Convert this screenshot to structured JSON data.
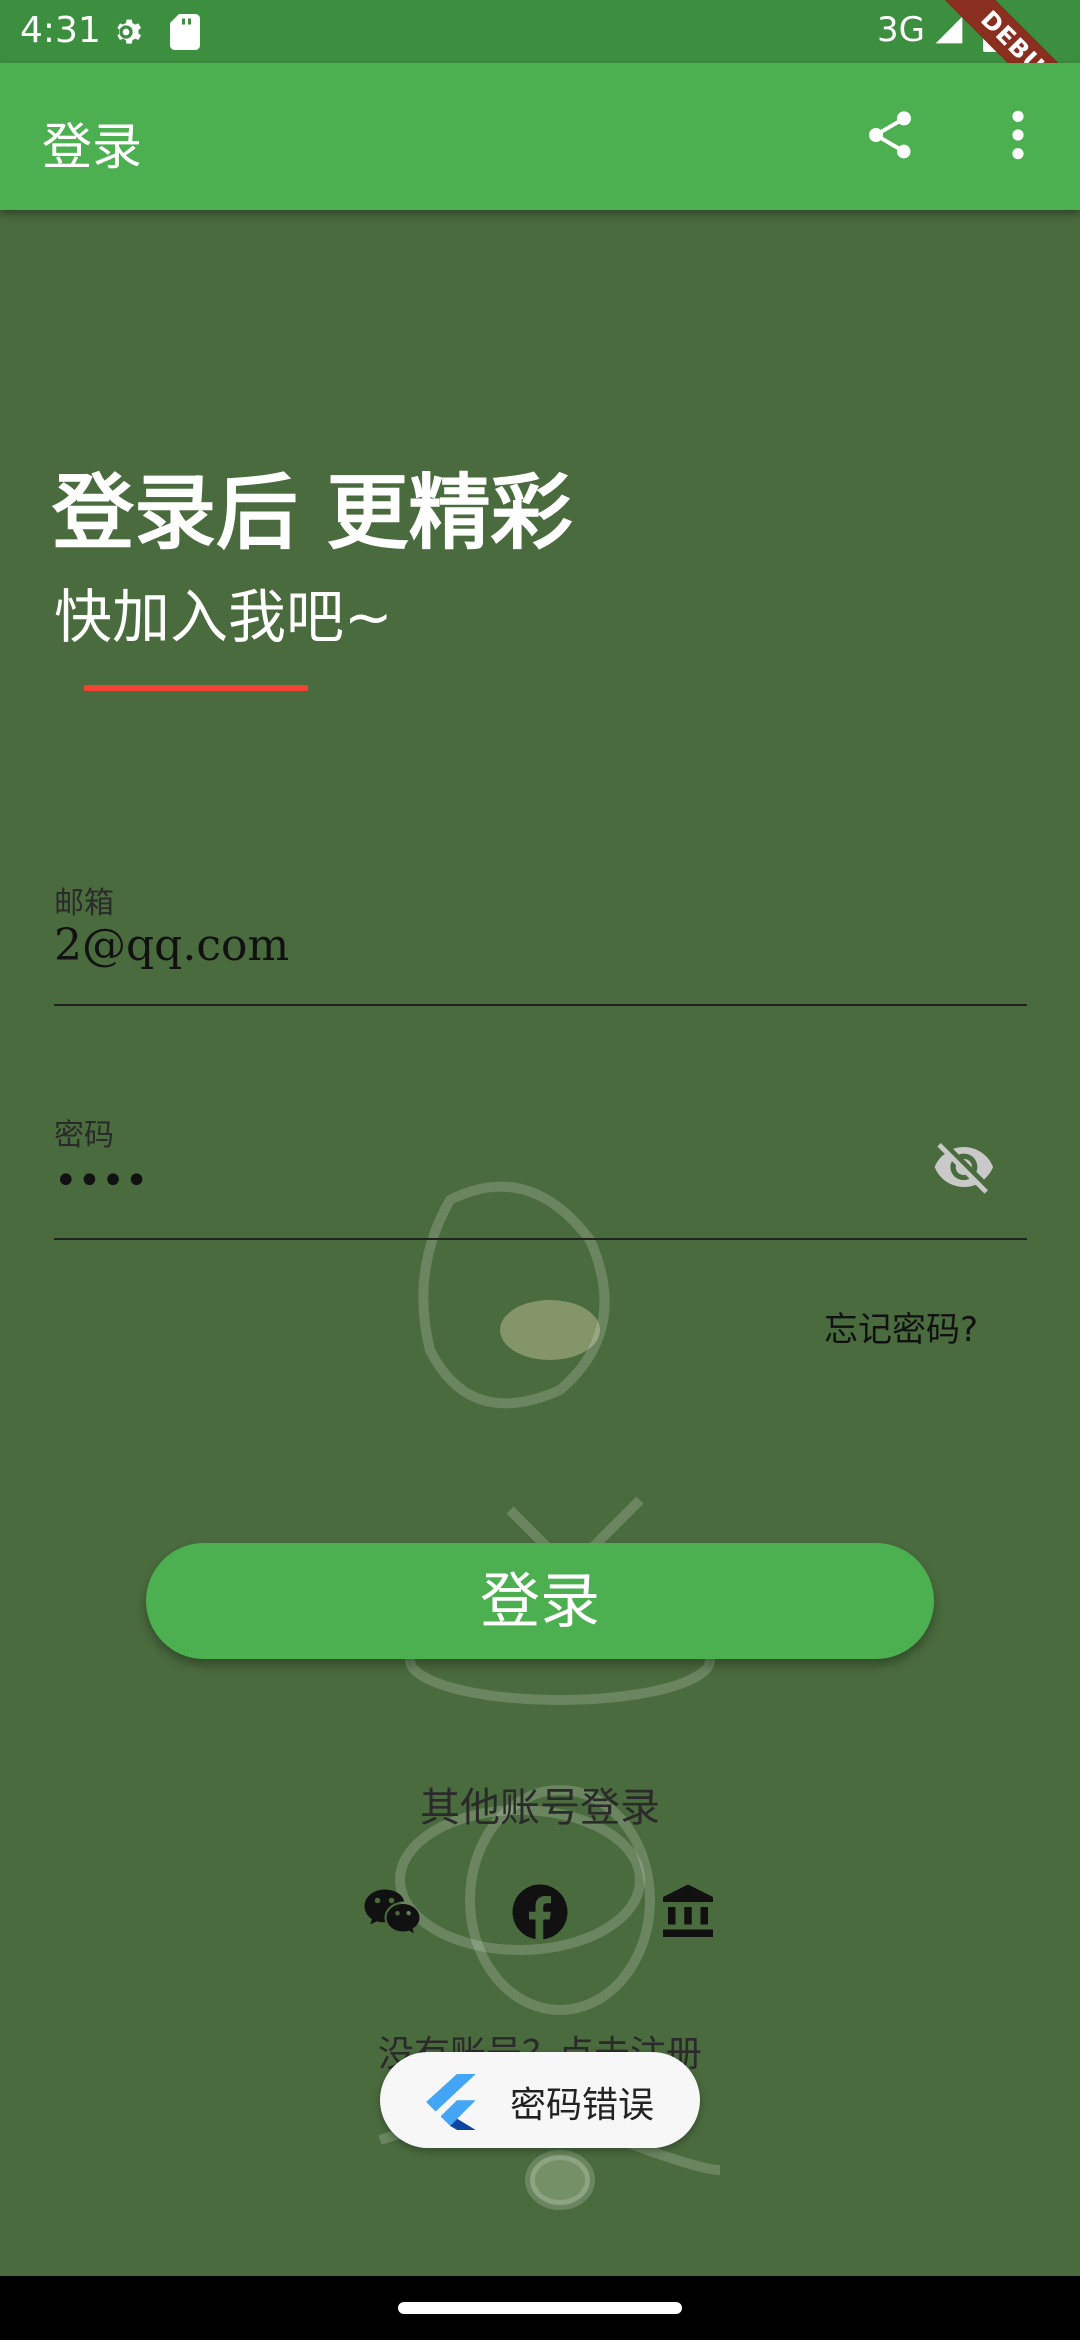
{
  "status_bar": {
    "time": "4:31",
    "network": "3G",
    "icons": [
      "gear-icon",
      "sd-card-icon",
      "signal-icon",
      "battery-icon"
    ]
  },
  "debug_banner": "DEBUG",
  "app_bar": {
    "title": "登录",
    "actions": [
      "share-icon",
      "more-vert-icon"
    ]
  },
  "hero": {
    "headline": "登录后 更精彩",
    "subheadline": "快加入我吧~"
  },
  "form": {
    "email": {
      "label": "邮箱",
      "value": "2@qq.com"
    },
    "password": {
      "label": "密码",
      "value": "••••"
    },
    "forgot_password": "忘记密码?"
  },
  "login_button": "登录",
  "other_login": {
    "label": "其他账号登录",
    "providers": [
      "wechat-icon",
      "facebook-icon",
      "bank-icon"
    ]
  },
  "register_hint": "没有账号？点击注册",
  "toast": {
    "text": "密码错误",
    "icon": "flutter-logo-icon"
  },
  "colors": {
    "app_bar": "#4caf50",
    "status_bar": "#3d8f40",
    "background": "#4a6b3e",
    "accent_line": "#f44336",
    "button": "#4caf50"
  }
}
